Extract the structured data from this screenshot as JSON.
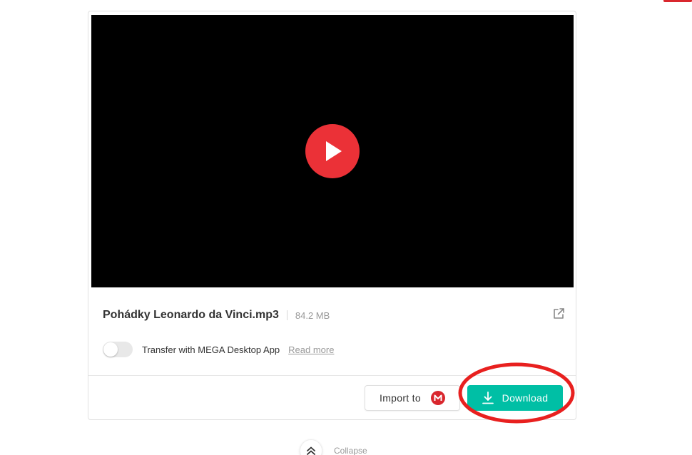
{
  "file": {
    "name": "Pohádky Leonardo da Vinci.mp3",
    "size": "84.2 MB"
  },
  "player": {
    "play_icon": "play-icon",
    "background_color": "#000000",
    "play_button_color": "#eb3137"
  },
  "transfer": {
    "label": "Transfer with MEGA Desktop App",
    "read_more": "Read more",
    "toggle_on": false
  },
  "actions": {
    "import_label": "Import to",
    "import_icon": "mega-logo-icon",
    "download_label": "Download",
    "download_icon": "download-icon",
    "download_color": "#00bfa5"
  },
  "footer": {
    "collapse_label": "Collapse",
    "collapse_icon": "double-chevron-up-icon"
  },
  "annotation": {
    "highlight_color": "#e8201f"
  }
}
